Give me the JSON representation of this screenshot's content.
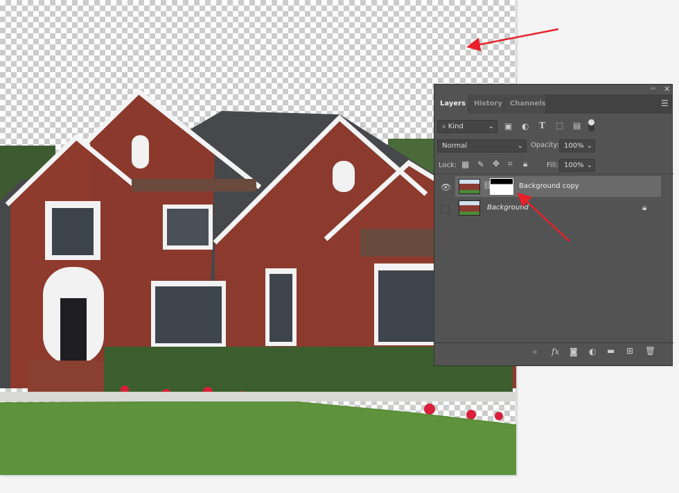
{
  "panel": {
    "tabs": [
      {
        "label": "Layers",
        "active": true
      },
      {
        "label": "History"
      },
      {
        "label": "Channels"
      }
    ],
    "filter": {
      "value": "Kind"
    },
    "blend_mode": "Normal",
    "opacity_label": "Opacity:",
    "opacity": "100%",
    "lock_label": "Lock:",
    "fill_label": "Fill:",
    "fill": "100%",
    "layers": [
      {
        "name": "Background copy",
        "visible": true,
        "selected": true,
        "has_mask": true
      },
      {
        "name": "Background",
        "visible": false,
        "locked": true
      }
    ],
    "footer_icons": [
      "link-icon",
      "fx-icon",
      "mask-icon",
      "adjustment-icon",
      "folder-icon",
      "new-layer-icon",
      "trash-icon"
    ]
  },
  "colors": {
    "annotation_arrow": "#e8202a",
    "panel_bg": "#535353"
  }
}
